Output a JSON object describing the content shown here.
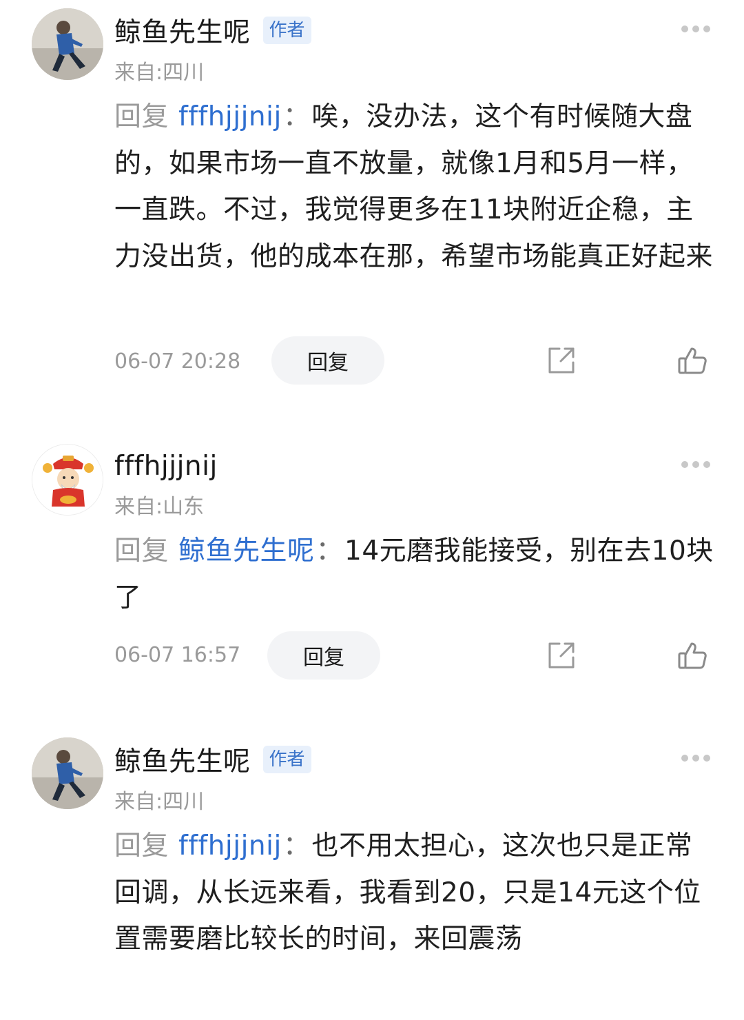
{
  "comments": [
    {
      "username": "鲸鱼先生呢",
      "badge": "作者",
      "location": "来自:四川",
      "reply_prefix": "回复",
      "mention": "fffhjjjnij",
      "colon": "：",
      "text": "唉，没办法，这个有时候随大盘的，如果市场一直不放量，就像1月和5月一样，一直跌。不过，我觉得更多在11块附近企稳，主力没出货，他的成本在那，希望市场能真正好起来",
      "time": "06-07 20:28",
      "reply_label": "回复"
    },
    {
      "username": "fffhjjjnij",
      "location": "来自:山东",
      "reply_prefix": "回复",
      "mention": "鲸鱼先生呢",
      "colon": "：",
      "text": "14元磨我能接受，别在去10块了",
      "time": "06-07 16:57",
      "reply_label": "回复"
    },
    {
      "username": "鲸鱼先生呢",
      "badge": "作者",
      "location": "来自:四川",
      "reply_prefix": "回复",
      "mention": "fffhjjjnij",
      "colon": "：",
      "text": "也不用太担心，这次也只是正常回调，从长远来看，我看到20，只是14元这个位置需要磨比较长的时间，来回震荡"
    }
  ],
  "icons": {
    "more": "more-dots-icon",
    "share": "share-icon",
    "like": "thumbs-up-icon"
  },
  "colors": {
    "mention": "#2f6fd0",
    "badge_text": "#3a73c9",
    "badge_bg": "#e8f0fb",
    "secondary_text": "#9a9a9a",
    "reply_button_bg": "#f3f4f6"
  }
}
